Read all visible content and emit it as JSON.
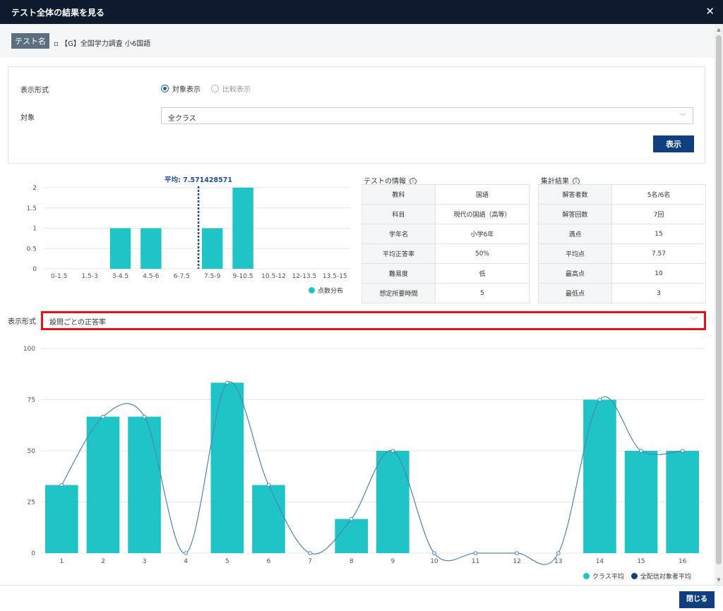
{
  "window": {
    "title": "テスト全体の結果を見る",
    "close_icon": "close-icon"
  },
  "test_name": {
    "badge": "テスト名",
    "value": "▫ 【G】全国学力調査 小6国語"
  },
  "filters": {
    "display_label": "表示形式",
    "radio_target": "対象表示",
    "radio_compare": "比較表示",
    "target_label": "対象",
    "target_value": "全クラス",
    "show_button": "表示"
  },
  "test_info": {
    "title": "テストの情報",
    "rows": [
      {
        "key": "教科",
        "value": "国語"
      },
      {
        "key": "科目",
        "value": "現代の国語（高等）"
      },
      {
        "key": "学年名",
        "value": "小学6年"
      },
      {
        "key": "平均正答率",
        "value": "50%"
      },
      {
        "key": "難易度",
        "value": "低"
      },
      {
        "key": "想定所要時間",
        "value": "5"
      }
    ]
  },
  "summary": {
    "title": "集計結果",
    "rows": [
      {
        "key": "解答者数",
        "value": "5名/6名"
      },
      {
        "key": "解答回数",
        "value": "7回"
      },
      {
        "key": "満点",
        "value": "15"
      },
      {
        "key": "平均点",
        "value": "7.57"
      },
      {
        "key": "最高点",
        "value": "10"
      },
      {
        "key": "最低点",
        "value": "3"
      }
    ]
  },
  "display_format": {
    "label": "表示形式",
    "value": "設問ごとの正答率"
  },
  "footer": {
    "close_button": "閉じる"
  },
  "colors": {
    "bar": "#1fc4c6",
    "line": "#4a86b8",
    "mean": "#1f4fa0",
    "dark_series": "#0f3f7d"
  },
  "chart_data": [
    {
      "type": "bar",
      "categories": [
        "0-1.5",
        "1.5-3",
        "3-4.5",
        "4.5-6",
        "6-7.5",
        "7.5-9",
        "9-10.5",
        "10.5-12",
        "12-13.5",
        "13.5-15"
      ],
      "series": [
        {
          "name": "点数分布",
          "values": [
            0,
            0,
            1,
            1,
            0,
            1,
            2,
            0,
            0,
            0
          ]
        }
      ],
      "yticks": [
        "0",
        "0.5",
        "1",
        "1.5",
        "2"
      ],
      "ylim": [
        0,
        2
      ],
      "mean": 7.571428571,
      "mean_label": "平均: 7.571428571",
      "legend": "bottom-right"
    },
    {
      "type": "bar",
      "categories": [
        "1",
        "2",
        "3",
        "4",
        "5",
        "6",
        "7",
        "8",
        "9",
        "10",
        "11",
        "12",
        "13",
        "14",
        "15",
        "16"
      ],
      "series": [
        {
          "name": "クラス平均",
          "type": "bar",
          "values": [
            33.3,
            66.7,
            66.7,
            0,
            83.3,
            33.3,
            0,
            16.7,
            50,
            0,
            0,
            0,
            0,
            75,
            50,
            50
          ]
        },
        {
          "name": "全配信対象者平均",
          "type": "line",
          "values": [
            33.3,
            66.7,
            66.7,
            0,
            83.3,
            33.3,
            0,
            16.7,
            50,
            0,
            0,
            0,
            0,
            75,
            50,
            50
          ]
        }
      ],
      "yticks": [
        "0",
        "25",
        "50",
        "75",
        "100"
      ],
      "ylim": [
        0,
        100
      ],
      "legend": "bottom-right"
    }
  ]
}
